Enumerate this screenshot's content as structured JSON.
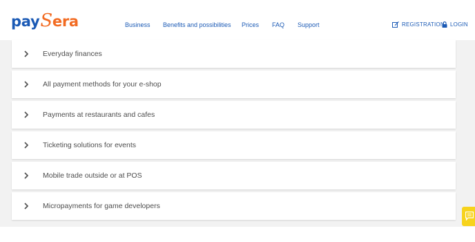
{
  "header": {
    "logo": {
      "part1": "pay",
      "part2": "S",
      "part3": "era"
    },
    "nav": [
      "Business",
      "Benefits and possibilities",
      "Prices",
      "FAQ",
      "Support"
    ],
    "registration_label": "REGISTRATION",
    "login_label": "LOGIN"
  },
  "accordion": {
    "items": [
      {
        "label": "Everyday finances"
      },
      {
        "label": "All payment methods for your e-shop"
      },
      {
        "label": "Payments at restaurants and cafes"
      },
      {
        "label": "Ticketing solutions for events"
      },
      {
        "label": "Mobile trade outside or at POS"
      },
      {
        "label": "Micropayments for game developers"
      }
    ]
  },
  "colors": {
    "brand_blue": "#1b5ab5",
    "brand_orange": "#f26b22",
    "chat_yellow": "#f7d31c",
    "background_gray": "#f2f2f2"
  },
  "icons": {
    "registration": "edit-icon",
    "login": "lock-icon",
    "row_expand": "chevron-right-icon",
    "chat": "chat-icon"
  }
}
